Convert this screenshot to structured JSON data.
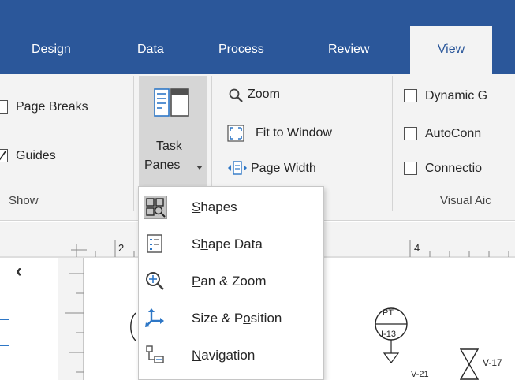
{
  "tabs": [
    {
      "label": "Design"
    },
    {
      "label": "Data"
    },
    {
      "label": "Process"
    },
    {
      "label": "Review"
    },
    {
      "label": "View",
      "active": true
    }
  ],
  "show_group": {
    "page_breaks": "Page Breaks",
    "guides": "Guides",
    "label": "Show"
  },
  "task_panes": {
    "line1": "Task",
    "line2": "Panes"
  },
  "zoom_group": {
    "zoom": "Zoom",
    "fit_to_window": "Fit to Window",
    "page_width": "Page Width"
  },
  "visual_aids": {
    "dynamic": "Dynamic G",
    "autoconn": "AutoConn",
    "connectio": "Connectio",
    "label": "Visual Aic"
  },
  "ruler": {
    "mark_2": "2",
    "mark_4": "4",
    "scroll_left": "‹"
  },
  "menu": {
    "items": [
      {
        "pre": "",
        "ul": "S",
        "post": "hapes",
        "icon": "shapes-icon",
        "active": true
      },
      {
        "pre": "S",
        "ul": "h",
        "post": "ape Data",
        "icon": "shape-data-icon"
      },
      {
        "pre": "",
        "ul": "P",
        "post": "an & Zoom",
        "icon": "pan-zoom-icon"
      },
      {
        "pre": "Size & P",
        "ul": "o",
        "post": "sition",
        "icon": "size-position-icon"
      },
      {
        "pre": "",
        "ul": "N",
        "post": "avigation",
        "icon": "navigation-icon"
      }
    ]
  },
  "diagram": {
    "pt_tag": "PT",
    "instrument": "I-13",
    "valve_17": "V-17",
    "valve_21": "V-21"
  },
  "colors": {
    "tabbar": "#2b579a",
    "ribbon": "#f3f3f3",
    "accent_blue": "#2b579a",
    "icon_blue": "#2e77c6"
  }
}
